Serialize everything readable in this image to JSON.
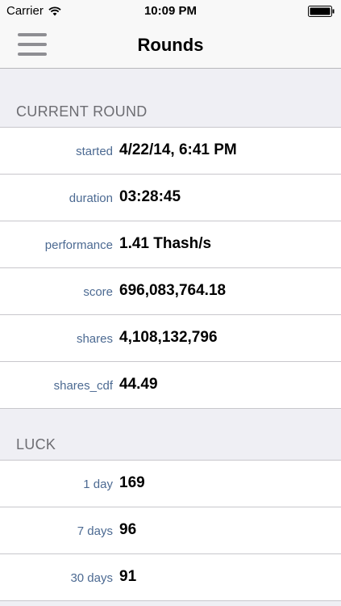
{
  "status_bar": {
    "carrier": "Carrier",
    "time": "10:09 PM"
  },
  "nav": {
    "title": "Rounds"
  },
  "current_round": {
    "header": "CURRENT ROUND",
    "rows": [
      {
        "label": "started",
        "value": "4/22/14, 6:41 PM"
      },
      {
        "label": "duration",
        "value": "03:28:45"
      },
      {
        "label": "performance",
        "value": "1.41 Thash/s"
      },
      {
        "label": "score",
        "value": "696,083,764.18"
      },
      {
        "label": "shares",
        "value": "4,108,132,796"
      },
      {
        "label": "shares_cdf",
        "value": "44.49"
      }
    ]
  },
  "luck": {
    "header": "LUCK",
    "rows": [
      {
        "label": "1 day",
        "value": "169"
      },
      {
        "label": "7 days",
        "value": "96"
      },
      {
        "label": "30 days",
        "value": "91"
      }
    ]
  },
  "icons": {
    "wifi": "wifi-icon",
    "battery": "battery-icon",
    "menu": "hamburger-menu-icon"
  }
}
